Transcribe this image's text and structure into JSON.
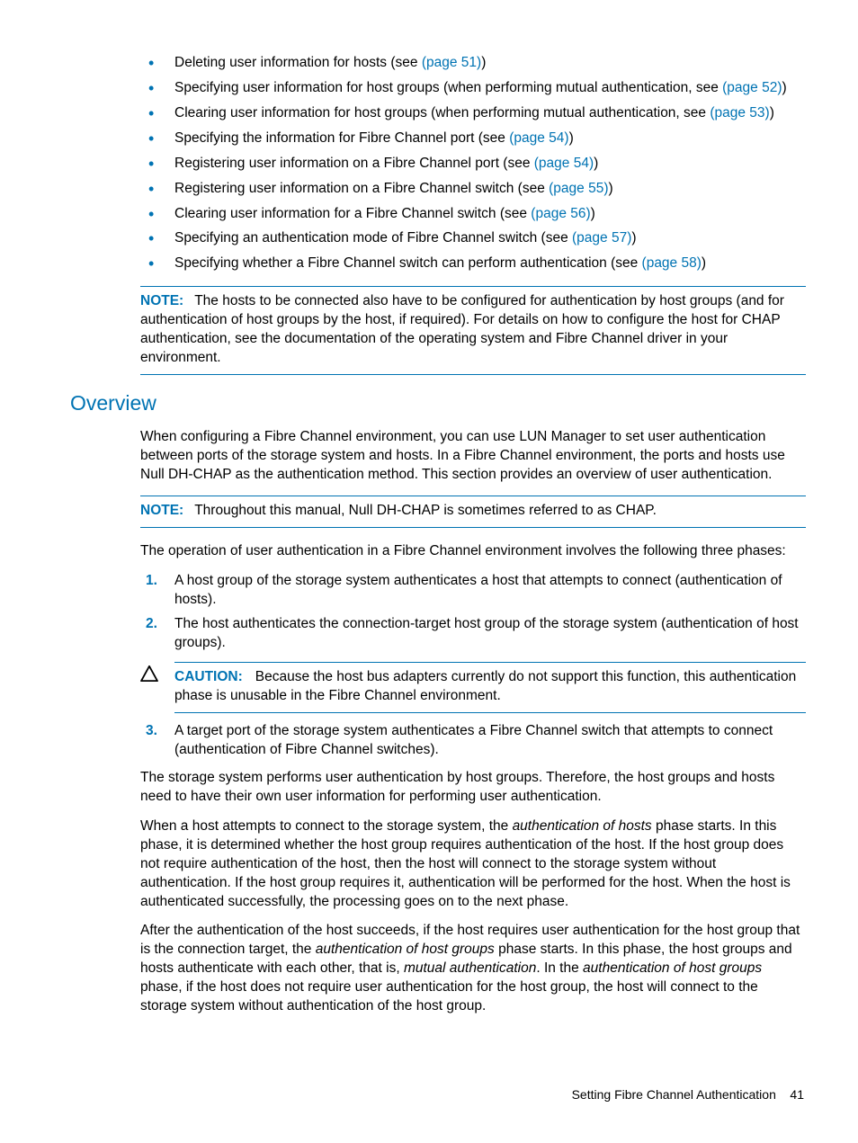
{
  "bullets": [
    {
      "pre": "Deleting user information for hosts (see ",
      "link": "(page 51)",
      "post": ")"
    },
    {
      "pre": "Specifying user information for host groups (when performing mutual authentication, see ",
      "link": "(page 52)",
      "post": ")"
    },
    {
      "pre": "Clearing user information for host groups (when performing mutual authentication, see ",
      "link": "(page 53)",
      "post": ")"
    },
    {
      "pre": "Specifying the information for Fibre Channel port (see ",
      "link": "(page 54)",
      "post": ")"
    },
    {
      "pre": "Registering user information on a Fibre Channel port (see ",
      "link": "(page 54)",
      "post": ")"
    },
    {
      "pre": "Registering user information on a Fibre Channel switch (see ",
      "link": "(page 55)",
      "post": ")"
    },
    {
      "pre": "Clearing user information for a Fibre Channel switch (see ",
      "link": "(page 56)",
      "post": ")"
    },
    {
      "pre": "Specifying an authentication mode of Fibre Channel switch (see ",
      "link": "(page 57)",
      "post": ")"
    },
    {
      "pre": "Specifying whether a Fibre Channel switch can perform authentication (see ",
      "link": "(page 58)",
      "post": ")"
    }
  ],
  "note1_label": "NOTE:",
  "note1_text": "The hosts to be connected also have to be configured for authentication by host groups (and for authentication of host groups by the host, if required). For details on how to configure the host for CHAP authentication, see the documentation of the operating system and Fibre Channel driver in your environment.",
  "overview_heading": "Overview",
  "overview_p1": "When configuring a Fibre Channel environment, you can use LUN Manager to set user authentication between ports of the storage system and hosts. In a Fibre Channel environment, the ports and hosts use Null DH-CHAP as the authentication method. This section provides an overview of user authentication.",
  "note2_label": "NOTE:",
  "note2_text": "Throughout this manual, Null DH-CHAP is sometimes referred to as CHAP.",
  "phases_intro": "The operation of user authentication in a Fibre Channel environment involves the following three phases:",
  "phase1": "A host group of the storage system authenticates a host that attempts to connect (authentication of hosts).",
  "phase2": "The host authenticates the connection-target host group of the storage system (authentication of host groups).",
  "caution_label": "CAUTION:",
  "caution_text": "Because the host bus adapters currently do not support this function, this authentication phase is unusable in the Fibre Channel environment.",
  "phase3": "A target port of the storage system authenticates a Fibre Channel switch that attempts to connect (authentication of Fibre Channel switches).",
  "para_storage": "The storage system performs user authentication by host groups. Therefore, the host groups and hosts need to have their own user information for performing user authentication.",
  "para_hostattempts_1": "When a host attempts to connect to the storage system, the ",
  "para_hostattempts_em1": "authentication of hosts",
  "para_hostattempts_2": " phase starts. In this phase, it is determined whether the host group requires authentication of the host. If the host group does not require authentication of the host, then the host will connect to the storage system without authentication. If the host group requires it, authentication will be performed for the host. When the host is authenticated successfully, the processing goes on to the next phase.",
  "para_after_1": "After the authentication of the host succeeds, if the host requires user authentication for the host group that is the connection target, the ",
  "para_after_em1": "authentication of host groups",
  "para_after_2": " phase starts. In this phase, the host groups and hosts authenticate with each other, that is, ",
  "para_after_em2": "mutual authentication",
  "para_after_3": ". In the ",
  "para_after_em3": "authentication of host groups",
  "para_after_4": " phase, if the host does not require user authentication for the host group, the host will connect to the storage system without authentication of the host group.",
  "footer_title": "Setting Fibre Channel Authentication",
  "footer_page": "41"
}
